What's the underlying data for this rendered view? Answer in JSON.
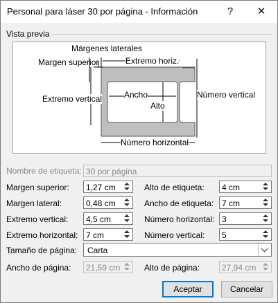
{
  "window": {
    "title": "Personal para láser 30 por página - Información",
    "help_glyph": "?",
    "close_glyph": "✕"
  },
  "preview": {
    "section_label": "Vista previa",
    "labels": {
      "side_margin": "Márgenes laterales",
      "top_margin": "Margen superior",
      "horizontal_pitch": "Extremo horiz.",
      "vertical_pitch": "Extremo vertical",
      "width": "Ancho",
      "height": "Alto",
      "number_down": "Número vertical",
      "number_across": "Número horizontal"
    }
  },
  "fields": {
    "label_name": {
      "label": "Nombre de etiqueta:",
      "value": "30 por página"
    },
    "top_margin": {
      "label": "Margen superior:",
      "value": "1,27 cm"
    },
    "side_margin": {
      "label": "Margen lateral:",
      "value": "0,48 cm"
    },
    "vertical_pitch": {
      "label": "Extremo vertical:",
      "value": "4,5 cm"
    },
    "horizontal_pitch": {
      "label": "Extremo horizontal:",
      "value": "7 cm"
    },
    "label_height": {
      "label": "Alto de etiqueta:",
      "value": "4 cm"
    },
    "label_width": {
      "label": "Ancho de etiqueta:",
      "value": "7 cm"
    },
    "number_across": {
      "label": "Número horizontal:",
      "value": "3"
    },
    "number_down": {
      "label": "Número vertical:",
      "value": "5"
    },
    "page_size": {
      "label": "Tamaño de página:",
      "value": "Carta"
    },
    "page_width": {
      "label": "Ancho de página:",
      "value": "21,59 cm"
    },
    "page_height": {
      "label": "Alto de página:",
      "value": "27,94 cm"
    }
  },
  "buttons": {
    "ok": "Aceptar",
    "cancel": "Cancelar"
  }
}
